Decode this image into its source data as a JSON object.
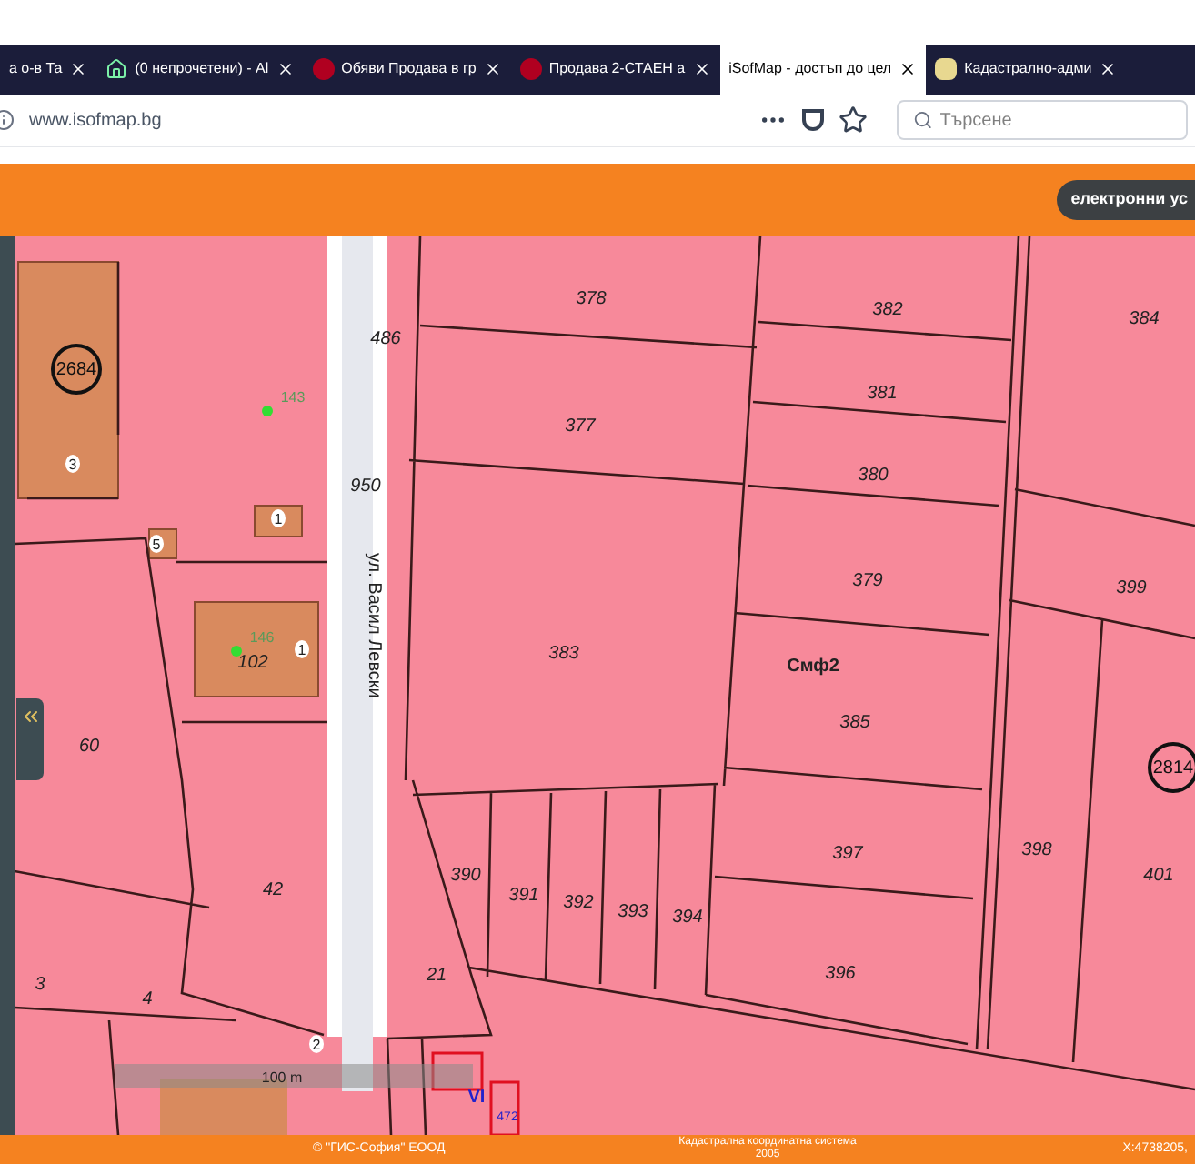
{
  "browser": {
    "tabs": [
      {
        "title": "а о-в Та",
        "selected": false
      },
      {
        "title": "(0 непрочетени) - Al",
        "selected": false
      },
      {
        "title": "Обяви Продава в гр",
        "selected": false
      },
      {
        "title": "Продава 2-СТАЕН а",
        "selected": false
      },
      {
        "title": "iSofMap - достъп до цел",
        "selected": true
      },
      {
        "title": "Кадастрално-адми",
        "selected": false
      }
    ],
    "address": "www.isofmap.bg",
    "search": {
      "placeholder": "Търсене"
    }
  },
  "header": {
    "button": "електронни ус"
  },
  "map": {
    "street": "ул. Васил Левски",
    "scale": "100 m",
    "labels": [
      {
        "text": "378",
        "kind": "parcel"
      },
      {
        "text": "382",
        "kind": "parcel"
      },
      {
        "text": "384",
        "kind": "parcel"
      },
      {
        "text": "486",
        "kind": "parcel"
      },
      {
        "text": "2684",
        "kind": "circled"
      },
      {
        "text": "377",
        "kind": "parcel"
      },
      {
        "text": "381",
        "kind": "parcel"
      },
      {
        "text": "380",
        "kind": "parcel"
      },
      {
        "text": "143",
        "kind": "point"
      },
      {
        "text": "3",
        "kind": "building"
      },
      {
        "text": "950",
        "kind": "parcel"
      },
      {
        "text": "1",
        "kind": "building"
      },
      {
        "text": "5",
        "kind": "building"
      },
      {
        "text": "379",
        "kind": "parcel"
      },
      {
        "text": "399",
        "kind": "parcel"
      },
      {
        "text": "383",
        "kind": "parcel"
      },
      {
        "text": "Смф2",
        "kind": "code"
      },
      {
        "text": "385",
        "kind": "parcel"
      },
      {
        "text": "2814",
        "kind": "circled"
      },
      {
        "text": "146",
        "kind": "point"
      },
      {
        "text": "102",
        "kind": "parcel"
      },
      {
        "text": "1",
        "kind": "building"
      },
      {
        "text": "60",
        "kind": "parcel"
      },
      {
        "text": "390",
        "kind": "parcel"
      },
      {
        "text": "391",
        "kind": "parcel"
      },
      {
        "text": "392",
        "kind": "parcel"
      },
      {
        "text": "393",
        "kind": "parcel"
      },
      {
        "text": "394",
        "kind": "parcel"
      },
      {
        "text": "397",
        "kind": "parcel"
      },
      {
        "text": "398",
        "kind": "parcel"
      },
      {
        "text": "401",
        "kind": "parcel"
      },
      {
        "text": "42",
        "kind": "parcel"
      },
      {
        "text": "396",
        "kind": "parcel"
      },
      {
        "text": "21",
        "kind": "parcel"
      },
      {
        "text": "3",
        "kind": "parcel"
      },
      {
        "text": "4",
        "kind": "parcel"
      },
      {
        "text": "2",
        "kind": "building"
      },
      {
        "text": "VI",
        "kind": "code"
      },
      {
        "text": "472",
        "kind": "small"
      }
    ]
  },
  "footer": {
    "copyright": "© \"ГИС-София\" ЕООД",
    "crs": "Кадастрална координатна система 2005",
    "coords": "X:4738205,"
  }
}
